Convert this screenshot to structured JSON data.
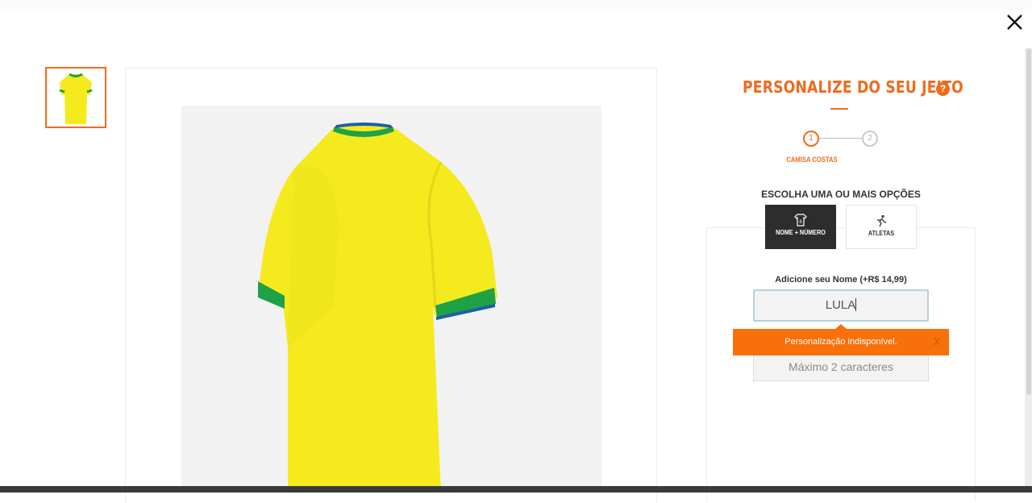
{
  "modal": {
    "close_icon": "close-icon"
  },
  "gallery": {
    "thumbnail_icon": "jersey-thumbnail",
    "main_image": "jersey-back-view",
    "colors": {
      "jersey": "#f5ea1e",
      "trim_green": "#1fa148",
      "trim_blue": "#1c5fa8"
    }
  },
  "panel": {
    "title": "PERSONALIZE DO SEU JEITO",
    "help_icon": "help-icon",
    "steps": [
      {
        "number": "1",
        "label": "CAMISA COSTAS",
        "active": true
      },
      {
        "number": "2",
        "label": "",
        "active": false
      }
    ],
    "options_heading": "ESCOLHA UMA OU MAIS OPÇÕES",
    "options": [
      {
        "label": "NOME + NÚMERO",
        "icon": "jersey-number-icon",
        "selected": true
      },
      {
        "label": "ATLETAS",
        "icon": "runner-icon",
        "selected": false
      }
    ],
    "name_field": {
      "label": "Adicione seu Nome (+R$ 14,99)",
      "value": "LULA"
    },
    "number_field": {
      "placeholder": "Máximo 2 caracteres"
    },
    "toast": {
      "message": "Personalização indisponível.",
      "close_label": "X"
    }
  },
  "theme": {
    "accent": "#f06a1c",
    "toast": "#f7700a",
    "dark_button": "#2d2d2d"
  }
}
